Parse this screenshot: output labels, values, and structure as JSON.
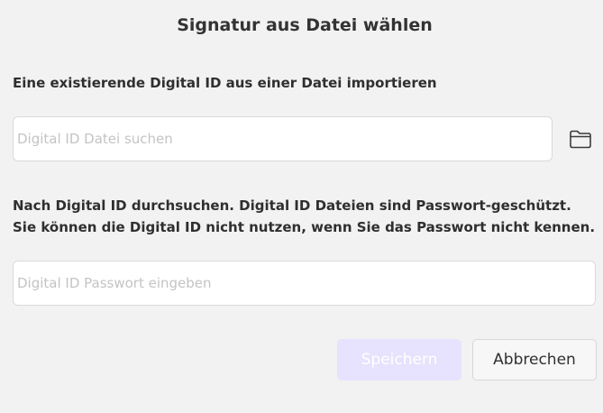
{
  "dialog": {
    "title": "Signatur aus Datei wählen"
  },
  "import_section": {
    "label": "Eine existierende Digital ID aus einer Datei importieren",
    "file_input_placeholder": "Digital ID Datei suchen",
    "file_input_value": "",
    "browse_icon": "folder-icon"
  },
  "password_section": {
    "description": "Nach Digital ID durchsuchen. Digital ID Dateien sind Passwort-geschützt. Sie können die Digital ID nicht nutzen, wenn Sie das Passwort nicht kennen.",
    "password_input_placeholder": "Digital ID Passwort eingeben",
    "password_input_value": ""
  },
  "buttons": {
    "save_label": "Speichern",
    "save_disabled": true,
    "cancel_label": "Abbrechen"
  },
  "colors": {
    "background": "#f2f2f2",
    "save_button_disabled_bg": "#e7e2fd",
    "input_border": "#dadada"
  }
}
